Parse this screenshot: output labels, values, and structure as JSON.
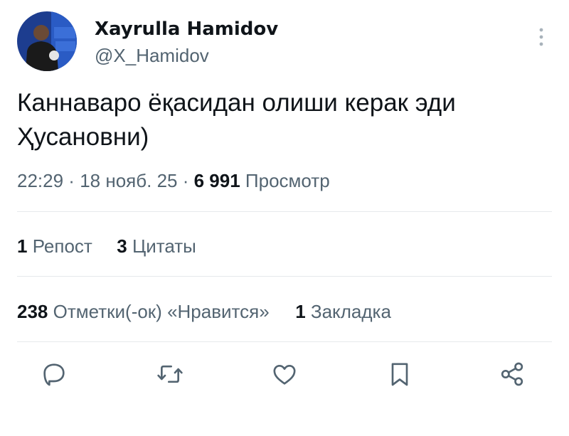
{
  "author": {
    "display_name": "Xayrulla Hamidov",
    "handle": "@X_Hamidov",
    "avatar_icon": "user-avatar-photo"
  },
  "tweet": {
    "text": "Каннаваро ёқасидан олиши керак эди\nҲусановни)"
  },
  "meta": {
    "time": "22:29",
    "separator": " · ",
    "date": "18 нояб. 25",
    "views_count": "6 991",
    "views_label": "Просмотр"
  },
  "stats": {
    "reposts_count": "1",
    "reposts_label": "Репост",
    "quotes_count": "3",
    "quotes_label": "Цитаты",
    "likes_count": "238",
    "likes_label": "Отметки(-ок) «Нравится»",
    "bookmarks_count": "1",
    "bookmarks_label": "Закладка"
  },
  "actions": [
    "reply-icon",
    "repost-icon",
    "like-icon",
    "bookmark-icon",
    "share-icon"
  ],
  "colors": {
    "text_primary": "#0f1419",
    "text_secondary": "#536471",
    "divider": "#e6e9ec"
  }
}
